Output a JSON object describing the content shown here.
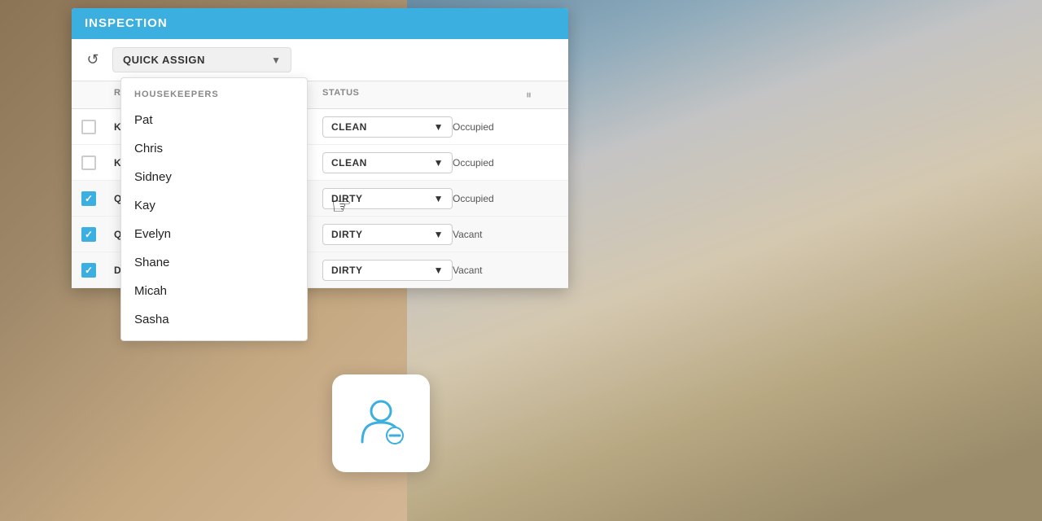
{
  "panel": {
    "title": "INSPECTION",
    "toolbar": {
      "quick_assign_label": "QUICK ASSIGN"
    },
    "table": {
      "headers": [
        "",
        "RO",
        "",
        "STATUS",
        ""
      ],
      "rows": [
        {
          "id": "row1",
          "room": "KS",
          "status_label": "CLEAN",
          "status_type": "clean",
          "occupancy": "Occupied",
          "checked": false
        },
        {
          "id": "row2",
          "room": "KS",
          "status_label": "CLEAN",
          "status_type": "clean",
          "occupancy": "Occupied",
          "checked": false
        },
        {
          "id": "row3",
          "room": "Q",
          "status_label": "DIRTY",
          "status_type": "dirty",
          "occupancy": "Occupied",
          "checked": true
        },
        {
          "id": "row4",
          "room": "Q",
          "status_label": "DIRTY",
          "status_type": "dirty",
          "occupancy": "Vacant",
          "checked": true
        },
        {
          "id": "row5",
          "room": "D",
          "status_label": "DIRTY",
          "status_type": "dirty",
          "occupancy": "Vacant",
          "checked": true
        }
      ]
    }
  },
  "housekeepers_dropdown": {
    "header": "HOUSEKEEPERS",
    "items": [
      {
        "id": "pat",
        "name": "Pat"
      },
      {
        "id": "chris",
        "name": "Chris"
      },
      {
        "id": "sidney",
        "name": "Sidney"
      },
      {
        "id": "kay",
        "name": "Kay"
      },
      {
        "id": "evelyn",
        "name": "Evelyn"
      },
      {
        "id": "shane",
        "name": "Shane"
      },
      {
        "id": "micah",
        "name": "Micah"
      },
      {
        "id": "sasha",
        "name": "Sasha"
      }
    ]
  },
  "colors": {
    "header_bg": "#3AAFE0",
    "accent": "#3AAFE0"
  }
}
